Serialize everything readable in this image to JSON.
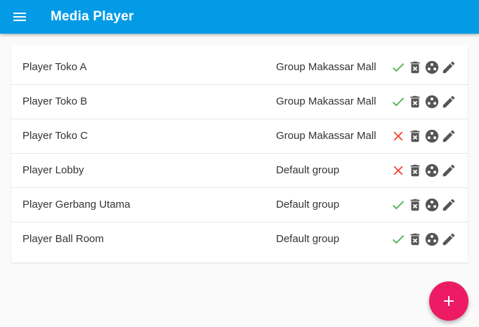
{
  "appbar": {
    "title": "Media Player",
    "menu_icon": "menu-icon",
    "color": "#039be5"
  },
  "players": [
    {
      "name": "Player Toko A",
      "group": "Group Makassar Mall",
      "status": "online"
    },
    {
      "name": "Player Toko B",
      "group": "Group Makassar Mall",
      "status": "online"
    },
    {
      "name": "Player Toko C",
      "group": "Group Makassar Mall",
      "status": "offline"
    },
    {
      "name": "Player Lobby",
      "group": "Default group",
      "status": "offline"
    },
    {
      "name": "Player Gerbang Utama",
      "group": "Default group",
      "status": "online"
    },
    {
      "name": "Player Ball Room",
      "group": "Default group",
      "status": "online"
    }
  ],
  "row_actions": [
    "delete-icon",
    "play-circle-icon",
    "edit-icon"
  ],
  "status_colors": {
    "online": "#4caf50",
    "offline": "#f44336"
  },
  "icon_color": "#555555",
  "fab": {
    "icon": "add-icon",
    "color": "#ec1b63"
  }
}
